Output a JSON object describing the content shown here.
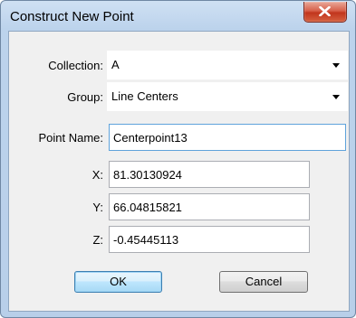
{
  "window": {
    "title": "Construct New Point"
  },
  "form": {
    "collection": {
      "label": "Collection:",
      "value": "A"
    },
    "group": {
      "label": "Group:",
      "value": "Line Centers"
    },
    "point_name": {
      "label": "Point Name:",
      "value": "Centerpoint13"
    },
    "x": {
      "label": "X:",
      "value": "81.30130924"
    },
    "y": {
      "label": "Y:",
      "value": "66.04815821"
    },
    "z": {
      "label": "Z:",
      "value": "-0.45445113"
    }
  },
  "buttons": {
    "ok": "OK",
    "cancel": "Cancel"
  },
  "icons": {
    "close": "close-icon",
    "dropdown": "chevron-down-icon"
  },
  "colors": {
    "title_bar": "#c4d8ee",
    "close_button": "#c94a32",
    "client_bg": "#f0f0f0",
    "default_button": "#bee6fd"
  }
}
